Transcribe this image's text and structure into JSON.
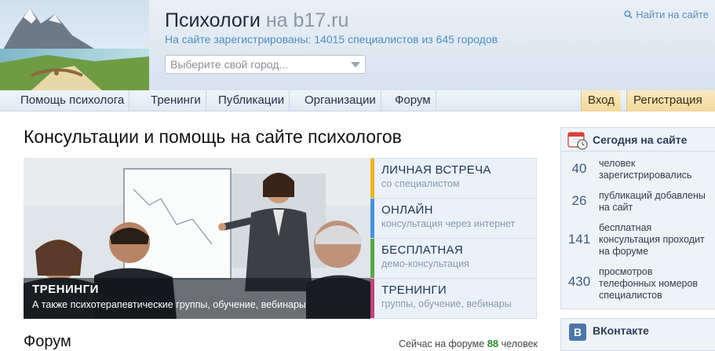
{
  "header": {
    "title": "Психологи",
    "title_domain": "на b17.ru",
    "stats": "На сайте зарегистрированы: 14015 специалистов из 645 городов",
    "city_placeholder": "Выберите свой город...",
    "search_link": "Найти на сайте"
  },
  "nav": {
    "items": [
      {
        "label": "Помощь психолога"
      },
      {
        "label": "Тренинги"
      },
      {
        "label": "Публикации"
      },
      {
        "label": "Организации"
      },
      {
        "label": "Форум"
      }
    ],
    "login": "Вход",
    "register": "Регистрация"
  },
  "main": {
    "heading": "Консультации и помощь на сайте психологов",
    "banner": {
      "title": "ТРЕНИНГИ",
      "subtitle": "А также психотерапевтические группы, обучение, вебинары"
    },
    "services": [
      {
        "title": "ЛИЧНАЯ ВСТРЕЧА",
        "subtitle": "со специалистом",
        "color": "#f0b429"
      },
      {
        "title": "ОНЛАЙН",
        "subtitle": "консультация через интернет",
        "color": "#4a90d9"
      },
      {
        "title": "БЕСПЛАТНАЯ",
        "subtitle": "демо-консультация",
        "color": "#5aa84a"
      },
      {
        "title": "ТРЕНИНГИ",
        "subtitle": "группы, обучение, вебинары",
        "color": "#c2457a"
      }
    ],
    "forum": {
      "title": "Форум",
      "online_prefix": "Сейчас на форуме",
      "online_count": "88",
      "online_suffix": "человек"
    }
  },
  "sidebar": {
    "today_title": "Сегодня на сайте",
    "stats": [
      {
        "number": "40",
        "text": "человек зарегистрировались"
      },
      {
        "number": "26",
        "text": "публикаций добавлены на сайт"
      },
      {
        "number": "141",
        "text": "бесплатная консультация проходит на форуме"
      },
      {
        "number": "430",
        "text": "просмотров телефонных номеров специалистов"
      }
    ],
    "vk_logo": "В",
    "vk_title": "ВКонтакте"
  }
}
